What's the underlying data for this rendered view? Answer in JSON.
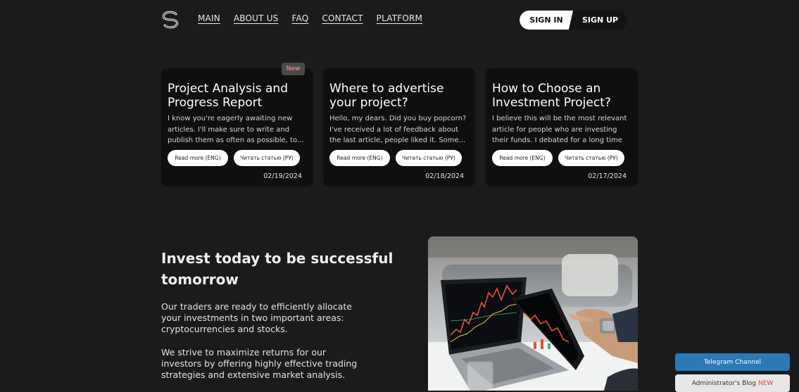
{
  "nav": {
    "items": [
      "MAIN",
      "ABOUT US",
      "FAQ",
      "CONTACT",
      "PLATFORM"
    ]
  },
  "auth": {
    "sign_in": "SIGN IN",
    "sign_up": "SIGN UP"
  },
  "articles": [
    {
      "badge": "New",
      "title": "Project Analysis and Progress Report",
      "excerpt": "I know you're eagerly awaiting new articles. I'll make sure to write and publish them as often as possible, to...",
      "read_eng": "Read more (ENG)",
      "read_ru": "Читать статью (РУ)",
      "date": "02/19/2024"
    },
    {
      "title": "Where to advertise your project?",
      "excerpt": "Hello, my dears. Did you buy popcorn? I've received a lot of feedback about the last article, people liked it. Some...",
      "read_eng": "Read more (ENG)",
      "read_ru": "Читать статью (РУ)",
      "date": "02/18/2024"
    },
    {
      "title": "How to Choose an Investment Project?",
      "excerpt": "I believe this will be the most relevant article for people who are investing their funds. I debated for a long time whethe...",
      "read_eng": "Read more (ENG)",
      "read_ru": "Читать статью (РУ)",
      "date": "02/17/2024"
    }
  ],
  "hero": {
    "title": "Invest today to be successful tomorrow",
    "p1": "Our traders are ready to efficiently allocate your investments in two important areas: cryptocurrencies and stocks.",
    "p2": "We strive to maximize returns for our investors by offering highly effective trading strategies and extensive market analysis."
  },
  "floating": {
    "telegram": "Telegram Channel",
    "blog": "Administrator's Blog",
    "blog_new": "NEW"
  },
  "colors": {
    "background": "#1c1b1c",
    "card": "#0f0f0f",
    "telegram": "#2a79b8",
    "new_text": "#e0433b"
  }
}
